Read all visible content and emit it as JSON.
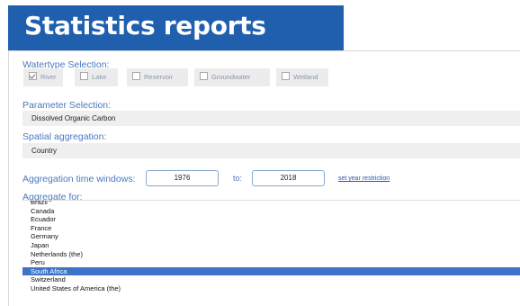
{
  "header": {
    "title": "Statistics reports"
  },
  "watertype": {
    "label": "Watertype Selection:",
    "options": [
      {
        "label": "River",
        "checked": true
      },
      {
        "label": "Lake",
        "checked": false
      },
      {
        "label": "Reservoir",
        "checked": false
      },
      {
        "label": "Groundwater",
        "checked": false
      },
      {
        "label": "Wetland",
        "checked": false
      }
    ]
  },
  "parameter": {
    "label": "Parameter Selection:",
    "value": "Dissolved Organic Carbon"
  },
  "spatial": {
    "label": "Spatial aggregation:",
    "value": "Country"
  },
  "time": {
    "label": "Aggregation time windows:",
    "from": "1976",
    "to_label": "to:",
    "to": "2018",
    "link": "set year restriction"
  },
  "aggregate": {
    "label": "Aggregate for:",
    "items": [
      {
        "label": "Brazil",
        "selected": false
      },
      {
        "label": "Canada",
        "selected": false
      },
      {
        "label": "Ecuador",
        "selected": false
      },
      {
        "label": "France",
        "selected": false
      },
      {
        "label": "Germany",
        "selected": false
      },
      {
        "label": "Japan",
        "selected": false
      },
      {
        "label": "Netherlands (the)",
        "selected": false
      },
      {
        "label": "Peru",
        "selected": false
      },
      {
        "label": "South Africa",
        "selected": true
      },
      {
        "label": "Switzerland",
        "selected": false
      },
      {
        "label": "United States of America (the)",
        "selected": false
      }
    ]
  }
}
